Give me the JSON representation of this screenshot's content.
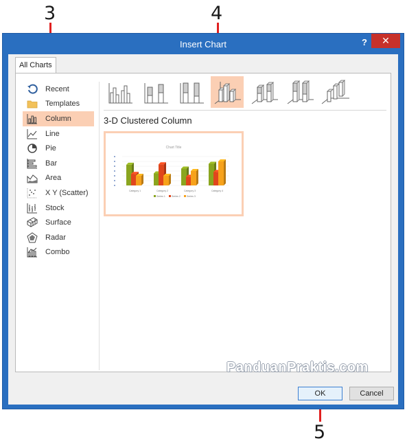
{
  "callouts": {
    "step3": "3",
    "step4": "4",
    "step5": "5",
    "line_color": "#e02020"
  },
  "window": {
    "title": "Insert Chart",
    "help_label": "?",
    "close_label": "✕",
    "title_color": "#2a6fc0",
    "close_color": "#c7312a"
  },
  "tabs": [
    {
      "label": "All Charts"
    }
  ],
  "chart_types": [
    {
      "label": "Recent",
      "icon": "recent-icon"
    },
    {
      "label": "Templates",
      "icon": "folder-icon"
    },
    {
      "label": "Column",
      "icon": "column-chart-icon",
      "selected": true
    },
    {
      "label": "Line",
      "icon": "line-chart-icon"
    },
    {
      "label": "Pie",
      "icon": "pie-chart-icon"
    },
    {
      "label": "Bar",
      "icon": "bar-chart-icon"
    },
    {
      "label": "Area",
      "icon": "area-chart-icon"
    },
    {
      "label": "X Y (Scatter)",
      "icon": "scatter-chart-icon"
    },
    {
      "label": "Stock",
      "icon": "stock-chart-icon"
    },
    {
      "label": "Surface",
      "icon": "surface-chart-icon"
    },
    {
      "label": "Radar",
      "icon": "radar-chart-icon"
    },
    {
      "label": "Combo",
      "icon": "combo-chart-icon"
    }
  ],
  "subtypes": {
    "selected_title": "3-D Clustered Column",
    "items": [
      {
        "icon": "clustered-column-icon"
      },
      {
        "icon": "stacked-column-icon"
      },
      {
        "icon": "100-stacked-column-icon"
      },
      {
        "icon": "3d-clustered-column-icon",
        "selected": true
      },
      {
        "icon": "3d-stacked-column-icon"
      },
      {
        "icon": "3d-100-stacked-column-icon"
      },
      {
        "icon": "3d-column-icon"
      }
    ]
  },
  "preview": {
    "chart_title": "Chart Title",
    "categories": [
      "Category 1",
      "Category 2",
      "Category 3",
      "Category 4"
    ],
    "series": [
      {
        "name": "Series 1",
        "values": [
          4.3,
          2.5,
          3.5,
          4.5
        ],
        "color": "#8aa51f"
      },
      {
        "name": "Series 2",
        "values": [
          2.4,
          4.4,
          1.8,
          2.8
        ],
        "color": "#e0461c"
      },
      {
        "name": "Series 3",
        "values": [
          2.0,
          2.0,
          3.0,
          5.0
        ],
        "color": "#f7a21b"
      }
    ]
  },
  "footer": {
    "ok_label": "OK",
    "cancel_label": "Cancel"
  },
  "watermark": "PanduanPraktis.com"
}
